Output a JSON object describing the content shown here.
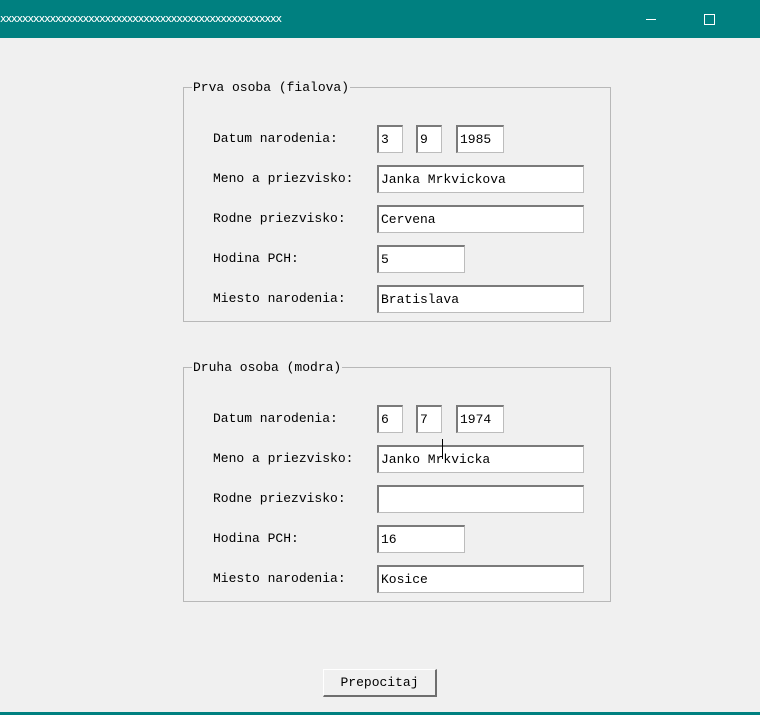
{
  "window": {
    "title": "xxxxxxxxxxxxxxxxxxxxxxxxxxxxxxxxxxxxxxxxxxxxxxxxxxx",
    "minimize_icon": "minimize-icon",
    "maximize_icon": "maximize-icon",
    "accent_color": "#008080"
  },
  "person1": {
    "legend": "Prva osoba (fialova)",
    "birth_date_label": "Datum narodenia:",
    "birth_day": "3",
    "birth_month": "9",
    "birth_year": "1985",
    "name_label": "Meno a priezvisko:",
    "name": "Janka Mrkvickova",
    "maiden_label": "Rodne priezvisko:",
    "maiden": "Cervena",
    "hour_label": "Hodina PCH:",
    "hour": "5",
    "place_label": "Miesto narodenia:",
    "place": "Bratislava"
  },
  "person2": {
    "legend": "Druha osoba (modra)",
    "birth_date_label": "Datum narodenia:",
    "birth_day": "6",
    "birth_month": "7",
    "birth_year": "1974",
    "name_label": "Meno a priezvisko:",
    "name": "Janko Mrkvicka",
    "maiden_label": "Rodne priezvisko:",
    "maiden": "",
    "hour_label": "Hodina PCH:",
    "hour": "16",
    "place_label": "Miesto narodenia:",
    "place": "Kosice"
  },
  "actions": {
    "recalculate_label": "Prepocitaj"
  }
}
